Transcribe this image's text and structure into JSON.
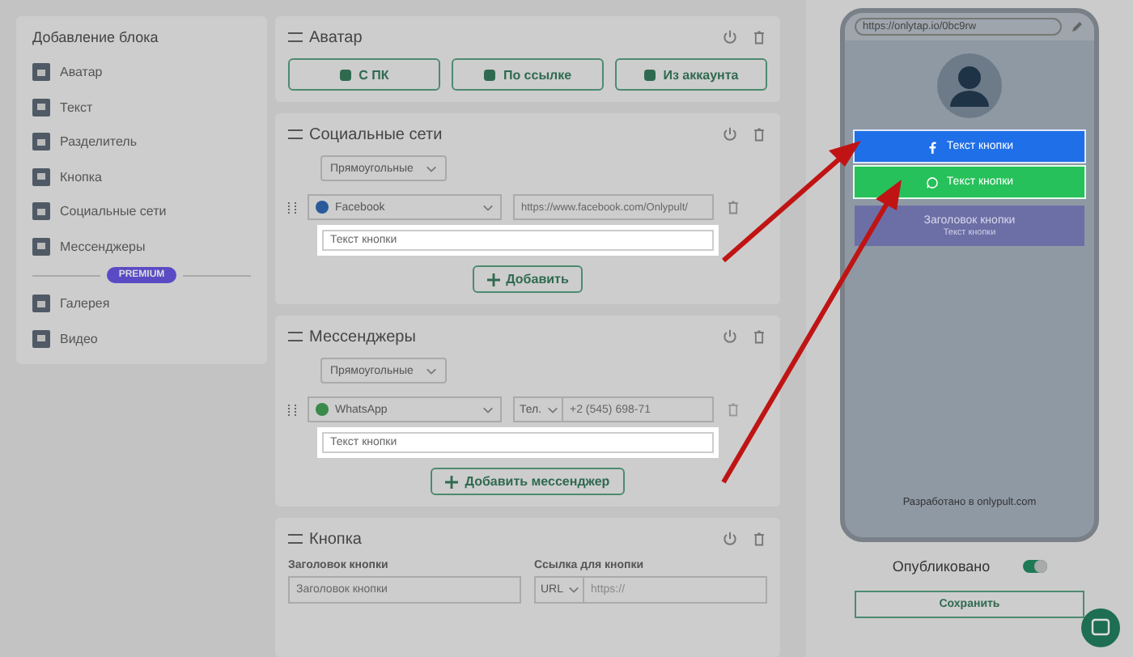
{
  "sidebar": {
    "title": "Добавление блока",
    "items": [
      {
        "label": "Аватар"
      },
      {
        "label": "Текст"
      },
      {
        "label": "Разделитель"
      },
      {
        "label": "Кнопка"
      },
      {
        "label": "Социальные сети"
      },
      {
        "label": "Мессенджеры"
      }
    ],
    "premium_badge": "PREMIUM",
    "premium_items": [
      {
        "label": "Галерея"
      },
      {
        "label": "Видео"
      }
    ]
  },
  "avatar_block": {
    "title": "Аватар",
    "buttons": [
      "С ПК",
      "По ссылке",
      "Из аккаунта"
    ]
  },
  "social_block": {
    "title": "Социальные сети",
    "shape": "Прямоугольные",
    "network": "Facebook",
    "url": "https://www.facebook.com/Onlypult/",
    "text_placeholder": "Текст кнопки",
    "add_button": "Добавить"
  },
  "messenger_block": {
    "title": "Мессенджеры",
    "shape": "Прямоугольные",
    "messenger": "WhatsApp",
    "phone_type": "Тел.",
    "phone": "+2 (545) 698-71",
    "text_placeholder": "Текст кнопки",
    "add_button": "Добавить мессенджер"
  },
  "button_block": {
    "title": "Кнопка",
    "title_label": "Заголовок кнопки",
    "title_value": "Заголовок кнопки",
    "link_label": "Ссылка для кнопки",
    "link_type": "URL",
    "link_placeholder": "https://"
  },
  "preview": {
    "url": "https://onlytap.io/0bc9rw",
    "buttons": [
      {
        "kind": "facebook",
        "label": "Текст кнопки"
      },
      {
        "kind": "whatsapp",
        "label": "Текст кнопки"
      },
      {
        "kind": "title",
        "label": "Заголовок кнопки",
        "subtitle": "Текст кнопки"
      }
    ],
    "footer": "Разработано в onlypult.com"
  },
  "publish": {
    "label": "Опубликовано",
    "on": true
  },
  "save_button": "Сохранить"
}
